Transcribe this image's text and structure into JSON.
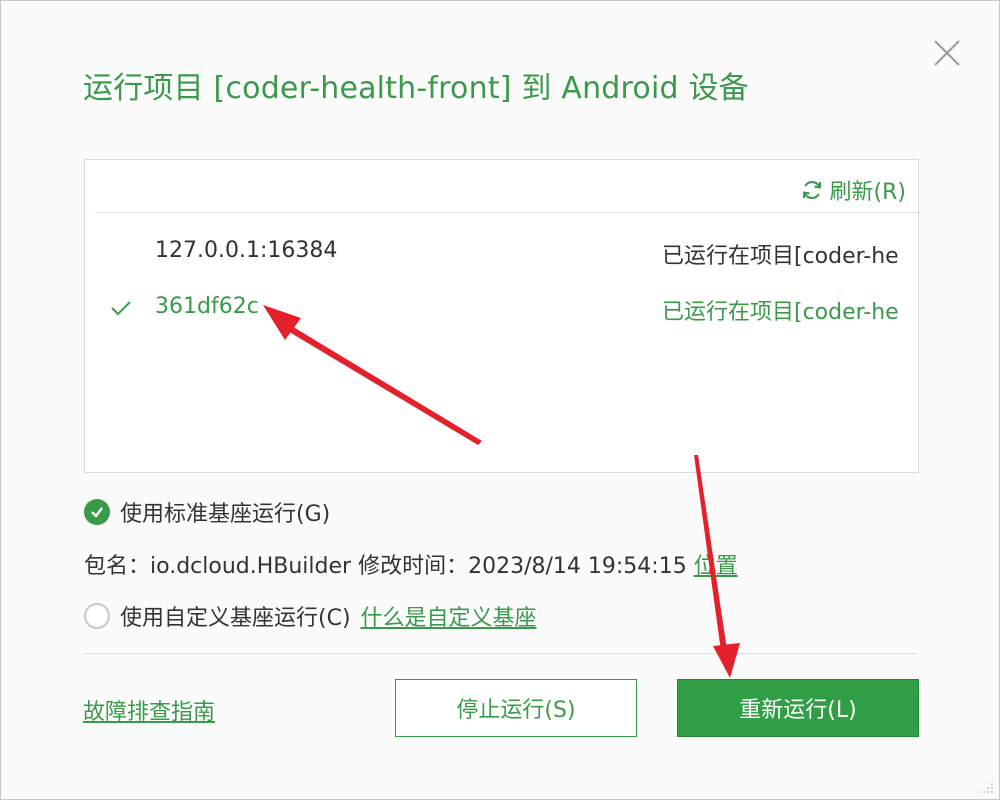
{
  "dialog": {
    "title": "运行项目 [coder-health-front] 到 Android 设备"
  },
  "device_panel": {
    "refresh_label": "刷新(R)",
    "devices": [
      {
        "name": "127.0.0.1:16384",
        "status": "已运行在项目[coder-he",
        "selected": false
      },
      {
        "name": "361df62c",
        "status": "已运行在项目[coder-he",
        "selected": true
      }
    ]
  },
  "options": {
    "standard_base": {
      "label": "使用标准基座运行(G)",
      "selected": true
    },
    "package_label": "包名：",
    "package_name": "io.dcloud.HBuilder",
    "modified_label": "修改时间：",
    "modified_time": "2023/8/14 19:54:15",
    "location_link": "位置",
    "custom_base": {
      "label": "使用自定义基座运行(C)",
      "selected": false
    },
    "what_is_custom_link": "什么是自定义基座"
  },
  "footer": {
    "troubleshoot_link": "故障排查指南",
    "stop_button": "停止运行(S)",
    "rerun_button": "重新运行(L)"
  },
  "colors": {
    "accent": "#3a9a4a",
    "primary_button": "#2f9e44",
    "annotation_arrow": "#e4212b"
  },
  "icons": [
    "close-icon",
    "refresh-icon",
    "check-icon",
    "radio-checked-icon",
    "radio-unchecked-icon",
    "resize-grip-icon"
  ]
}
